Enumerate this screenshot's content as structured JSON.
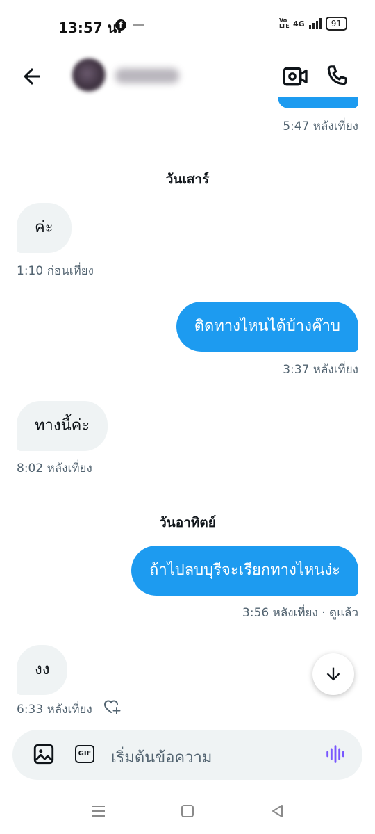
{
  "status_bar": {
    "time": "13:57 น.",
    "network_small": "Vo LTE",
    "network": "4G",
    "battery": "91"
  },
  "header": {
    "back_icon": "arrow-left-icon",
    "video_icon": "video-camera-icon",
    "call_icon": "phone-icon"
  },
  "messages": {
    "top_time": "5:47 หลังเที่ยง",
    "day_1": "วันเสาร์",
    "m1_text": "ค่ะ",
    "m1_time": "1:10 ก่อนเที่ยง",
    "m2_text": "ติดทางไหนได้บ้างค๊าบ",
    "m2_time": "3:37 หลังเที่ยง",
    "m3_text": "ทางนี้ค่ะ",
    "m3_time": "8:02 หลังเที่ยง",
    "day_2": "วันอาทิตย์",
    "m4_text": "ถ้าไปลบบุรีจะเรียกทางไหนง่ะ",
    "m4_time": "3:56 หลังเที่ยง · ดูแล้ว",
    "m5_text": "งง",
    "m5_time": "6:33 หลังเที่ยง"
  },
  "composer": {
    "placeholder": "เริ่มต้นข้อความ",
    "gif_label": "GIF"
  },
  "colors": {
    "accent": "#1d9bf0",
    "incoming_bubble": "#eff3f4",
    "secondary_text": "#536471",
    "voice_icon": "#7856ff"
  }
}
